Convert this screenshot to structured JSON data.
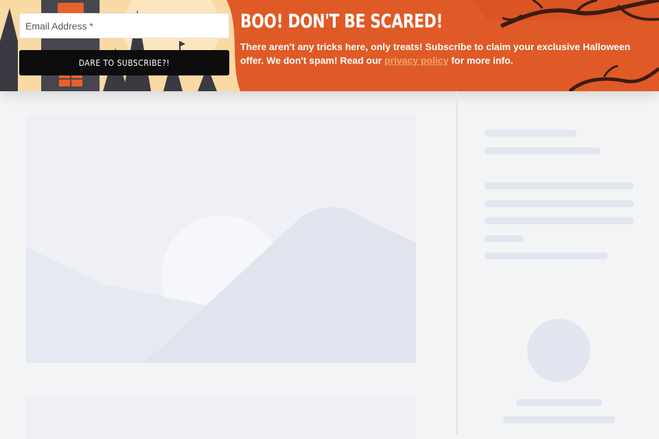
{
  "banner": {
    "email_placeholder": "Email Address *",
    "subscribe_label": "DARE TO SUBSCRIBE?!",
    "title": "BOO! DON'T BE SCARED!",
    "text_before": "There aren't any tricks here, only treats! Subscribe to claim your exclusive Halloween offer. We don't spam! Read our ",
    "privacy_link": "privacy policy",
    "text_after": " for more info.",
    "colors": {
      "banner_bg": "#df5a26",
      "left_art_bg": "#f9d9a4",
      "button_bg": "#0d0d0d",
      "link": "#f4a36c"
    }
  },
  "page": {
    "background": "#f3f4f6",
    "skeleton_color": "#e3e5f0"
  }
}
